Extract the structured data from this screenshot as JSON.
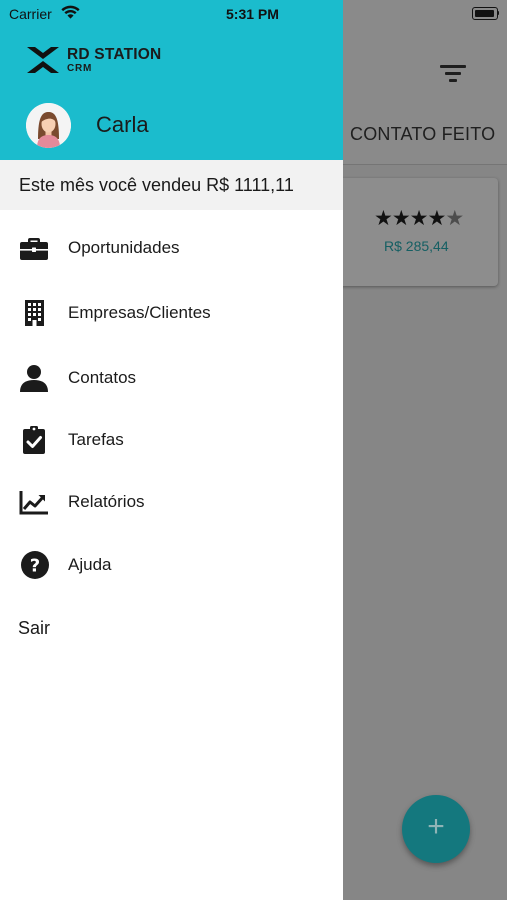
{
  "status_bar": {
    "carrier": "Carrier",
    "time": "5:31 PM"
  },
  "app": {
    "logo_name": "RD STATION",
    "logo_sub": "CRM"
  },
  "user": {
    "name": "Carla"
  },
  "sales_summary": "Este mês você vendeu R$ 1111,11",
  "menu": {
    "items": [
      {
        "label": "Oportunidades",
        "icon": "briefcase-icon"
      },
      {
        "label": "Empresas/Clientes",
        "icon": "building-icon"
      },
      {
        "label": "Contatos",
        "icon": "person-icon"
      },
      {
        "label": "Tarefas",
        "icon": "clipboard-check-icon"
      },
      {
        "label": "Relatórios",
        "icon": "chart-line-icon"
      },
      {
        "label": "Ajuda",
        "icon": "help-circle-icon"
      }
    ],
    "logout": "Sair"
  },
  "background": {
    "column_title": "CONTATO FEITO",
    "deal_card": {
      "rating": 4,
      "rating_max": 5,
      "value": "R$ 285,44"
    },
    "fab_label": "+"
  },
  "colors": {
    "header": "#1bbccd",
    "accent": "#14787e",
    "overlay": "#868686"
  }
}
